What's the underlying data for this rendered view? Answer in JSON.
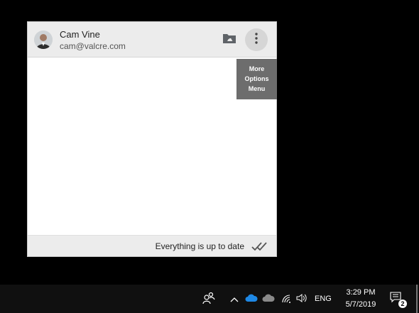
{
  "account": {
    "name": "Cam Vine",
    "email": "cam@valcre.com"
  },
  "header": {
    "drive_icon": "drive-folder-icon",
    "more_icon": "vertical-dots-icon"
  },
  "tooltip": {
    "line1": "More",
    "line2": "Options",
    "line3": "Menu"
  },
  "footer": {
    "status": "Everything is up to date",
    "status_icon": "double-check-icon"
  },
  "taskbar": {
    "people_icon": "people-icon",
    "chevron_icon": "chevron-up-icon",
    "onedrive_business_icon": "cloud-blue-icon",
    "onedrive_personal_icon": "cloud-gray-icon",
    "wifi_icon": "wifi-icon",
    "volume_icon": "volume-icon",
    "language": "ENG",
    "time": "3:29 PM",
    "date": "5/7/2019",
    "notification_count": "2",
    "colors": {
      "onedrive_blue": "#1e88e5",
      "background": "#101010"
    }
  }
}
